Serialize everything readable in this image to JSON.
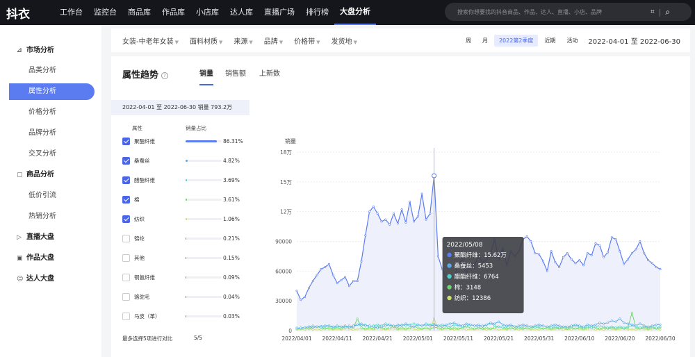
{
  "app": {
    "logo": "抖衣"
  },
  "nav": [
    "工作台",
    "监控台",
    "商品库",
    "作品库",
    "小店库",
    "达人库",
    "直播广场",
    "排行榜",
    "大盘分析"
  ],
  "search": {
    "placeholder": "搜索你想要找的抖音商品、作品、达人、直播、小店、品牌",
    "scan_icon": "scan-icon",
    "search_icon": "search-icon"
  },
  "sidebar": {
    "groups": [
      {
        "label": "市场分析",
        "icon": "chart-icon"
      },
      {
        "label": "商品分析",
        "icon": "box-icon"
      },
      {
        "label": "直播大盘",
        "icon": "live-icon"
      },
      {
        "label": "作品大盘",
        "icon": "video-icon"
      },
      {
        "label": "达人大盘",
        "icon": "user-icon"
      }
    ],
    "items": [
      "品类分析",
      "属性分析",
      "价格分析",
      "品牌分析",
      "交叉分析",
      "低价引流",
      "热销分析"
    ]
  },
  "filters": [
    "女装-中老年女装",
    "面料材质",
    "来源",
    "品牌",
    "价格带",
    "发货地"
  ],
  "periods": [
    "周",
    "月",
    "2022第2季度",
    "近期",
    "活动"
  ],
  "date_range": "2022-04-01 至 2022-06-30",
  "panel": {
    "title": "属性趋势",
    "tabs": [
      "销量",
      "销售额",
      "上新数"
    ],
    "summary": "2022-04-01 至 2022-06-30 销量 793.2万",
    "col_attr": "属性",
    "col_share": "销量占比",
    "footer_note": "最多选择5项进行对比",
    "footer_count": "5/5"
  },
  "attributes": [
    {
      "name": "聚酯纤维",
      "pct": "86.31%",
      "share": 0.8631,
      "checked": true,
      "color": "#5b7cf0"
    },
    {
      "name": "桑蚕丝",
      "pct": "4.82%",
      "share": 0.0482,
      "checked": true,
      "color": "#5aa9e6"
    },
    {
      "name": "醋酯纤维",
      "pct": "3.69%",
      "share": 0.0369,
      "checked": true,
      "color": "#4fd1c5"
    },
    {
      "name": "棉",
      "pct": "3.61%",
      "share": 0.0361,
      "checked": true,
      "color": "#6fd36f"
    },
    {
      "name": "纺织",
      "pct": "1.06%",
      "share": 0.0106,
      "checked": true,
      "color": "#c8e06a"
    },
    {
      "name": "锦纶",
      "pct": "0.21%",
      "share": 0.0021,
      "checked": false,
      "color": "#5b7cf0"
    },
    {
      "name": "其他",
      "pct": "0.15%",
      "share": 0.0015,
      "checked": false,
      "color": "#5b7cf0"
    },
    {
      "name": "铜氨纤维",
      "pct": "0.09%",
      "share": 0.0009,
      "checked": false,
      "color": "#5b7cf0"
    },
    {
      "name": "骆驼毛",
      "pct": "0.04%",
      "share": 0.0004,
      "checked": false,
      "color": "#5b7cf0"
    },
    {
      "name": "马皮（革）",
      "pct": "0.03%",
      "share": 0.0003,
      "checked": false,
      "color": "#5b7cf0"
    }
  ],
  "chart_data": {
    "type": "line",
    "ylabel": "销量",
    "y_ticks": [
      "0",
      "30000",
      "60000",
      "90000",
      "12万",
      "15万",
      "18万"
    ],
    "ylim": [
      0,
      180000
    ],
    "x_ticks": [
      "2022/04/01",
      "2022/04/11",
      "2022/04/21",
      "2022/05/01",
      "2022/05/11",
      "2022/05/21",
      "2022/05/31",
      "2022/06/10",
      "2022/06/20",
      "2022/06/30"
    ],
    "series": [
      {
        "name": "聚酯纤维",
        "color": "#5b7cf0",
        "values": [
          40000,
          31000,
          34000,
          43000,
          50000,
          56000,
          62000,
          64000,
          67000,
          56000,
          48000,
          51000,
          54000,
          45000,
          50000,
          50000,
          70000,
          96000,
          120000,
          125000,
          118000,
          110000,
          112000,
          107000,
          118000,
          108000,
          122000,
          109000,
          130000,
          110000,
          115000,
          138000,
          112000,
          118000,
          156200,
          75000,
          62000,
          53000,
          55000,
          54000,
          67000,
          72000,
          58000,
          68000,
          66000,
          75000,
          69000,
          72000,
          78000,
          92000,
          72000,
          83000,
          66000,
          80000,
          75000,
          80000,
          92000,
          95000,
          90000,
          78000,
          77000,
          70000,
          60000,
          80000,
          69000,
          64000,
          74000,
          78000,
          72000,
          68000,
          71000,
          66000,
          78000,
          76000,
          88000,
          86000,
          74000,
          79000,
          94000,
          92000,
          80000,
          67000,
          72000,
          78000,
          82000,
          90000,
          78000,
          71000,
          68000,
          64000,
          62000
        ]
      },
      {
        "name": "桑蚕丝",
        "color": "#5aa9e6",
        "values": [
          2000,
          3000,
          3000,
          4000,
          3000,
          4000,
          4500,
          5000,
          5000,
          4000,
          5000,
          4000,
          5000,
          3000,
          5000,
          6000,
          7000,
          5000,
          5000,
          4000,
          3000,
          4000,
          5000,
          6000,
          4000,
          6000,
          5000,
          7000,
          5000,
          4000,
          6000,
          5000,
          6000,
          5000,
          5453,
          5000,
          4000,
          6000,
          7000,
          8000,
          6000,
          5000,
          7000,
          6000,
          5000,
          6000,
          4000,
          6000,
          8000,
          7000,
          9000,
          6000,
          5000,
          6000,
          4000,
          5000,
          6000,
          5000,
          4000,
          5000,
          6000,
          5000,
          4000,
          5000,
          6000,
          5000,
          4000,
          4000,
          5000,
          6000,
          5000,
          4000,
          6000,
          5000,
          6000,
          8000,
          7000,
          8000,
          10000,
          9000,
          12000,
          8000,
          7000,
          6000,
          5000,
          7000,
          5000,
          4000,
          5000,
          6000,
          6000
        ]
      },
      {
        "name": "醋酯纤维",
        "color": "#4fd1c5",
        "values": [
          3000,
          2000,
          3000,
          4000,
          5000,
          4000,
          3000,
          4000,
          5000,
          3000,
          4000,
          4000,
          3000,
          5000,
          4000,
          6000,
          5000,
          6000,
          4000,
          5000,
          6000,
          5000,
          7000,
          6000,
          5000,
          4000,
          6000,
          5000,
          6000,
          7000,
          6000,
          5000,
          7000,
          6000,
          6764,
          5000,
          6000,
          5000,
          4000,
          6000,
          5000,
          4000,
          5000,
          6000,
          5000,
          4000,
          5000,
          6000,
          7000,
          5000,
          4000,
          3000,
          4000,
          5000,
          4000,
          3000,
          4000,
          5000,
          4000,
          3000,
          4000,
          5000,
          4000,
          3000,
          4000,
          3000,
          4000,
          3000,
          4000,
          5000,
          4000,
          3000,
          4000,
          3000,
          4000,
          5000,
          4000,
          3000,
          4000,
          3000,
          4000,
          3000,
          4000,
          5000,
          4000,
          3000,
          4000,
          3000,
          4000,
          3000,
          4000
        ]
      },
      {
        "name": "棉",
        "color": "#6fd36f",
        "values": [
          2000,
          2500,
          3000,
          2000,
          3000,
          4000,
          3000,
          2000,
          3000,
          2000,
          3000,
          2000,
          4000,
          3000,
          3000,
          12000,
          3000,
          2000,
          3000,
          2000,
          4000,
          3000,
          2000,
          3000,
          4000,
          2000,
          3000,
          2000,
          3000,
          4000,
          3000,
          2000,
          3000,
          2000,
          3148,
          3000,
          2000,
          3000,
          2000,
          3000,
          2000,
          3000,
          4000,
          3000,
          2000,
          3000,
          2000,
          3000,
          2000,
          3000,
          4000,
          3000,
          2000,
          3000,
          2000,
          3000,
          2000,
          3000,
          2000,
          4000,
          3000,
          2000,
          3000,
          2000,
          3000,
          2000,
          3000,
          2000,
          3000,
          2000,
          3000,
          2000,
          3000,
          4000,
          3000,
          2000,
          3000,
          2000,
          3000,
          2000,
          3000,
          2000,
          3000,
          18000,
          3000,
          2000,
          3000,
          2000,
          3000,
          2000,
          3000
        ]
      },
      {
        "name": "纺织",
        "color": "#c8e06a",
        "values": [
          1000,
          1500,
          1000,
          2000,
          1000,
          1500,
          1000,
          2000,
          1500,
          1000,
          1500,
          1000,
          2000,
          1500,
          1000,
          1500,
          2000,
          1000,
          1500,
          1000,
          2000,
          1500,
          1000,
          1500,
          2000,
          1000,
          1500,
          1000,
          2000,
          1500,
          1000,
          1500,
          2000,
          1000,
          12386,
          1500,
          1000,
          2000,
          1500,
          1000,
          1500,
          2000,
          1000,
          1500,
          1000,
          2000,
          1500,
          1000,
          1500,
          2000,
          1000,
          1500,
          1000,
          2000,
          1500,
          1000,
          1500,
          2000,
          1000,
          1500,
          1000,
          2000,
          1500,
          1000,
          1500,
          2000,
          1000,
          1500,
          1000,
          2000,
          1500,
          1000,
          1500,
          2000,
          1000,
          1500,
          1000,
          2000,
          1500,
          1000,
          1500,
          2000,
          1000,
          1500,
          1000,
          2000,
          1500,
          1000,
          1500,
          2000,
          1000
        ]
      }
    ],
    "tooltip": {
      "date": "2022/05/08",
      "index": 34,
      "items": [
        {
          "label": "聚酯纤维",
          "value": "15.62万",
          "color": "#5b7cf0"
        },
        {
          "label": "桑蚕丝",
          "value": "5453",
          "color": "#5aa9e6"
        },
        {
          "label": "醋酯纤维",
          "value": "6764",
          "color": "#4fd1c5"
        },
        {
          "label": "棉",
          "value": "3148",
          "color": "#6fd36f"
        },
        {
          "label": "纺织",
          "value": "12386",
          "color": "#c8e06a"
        }
      ]
    }
  }
}
